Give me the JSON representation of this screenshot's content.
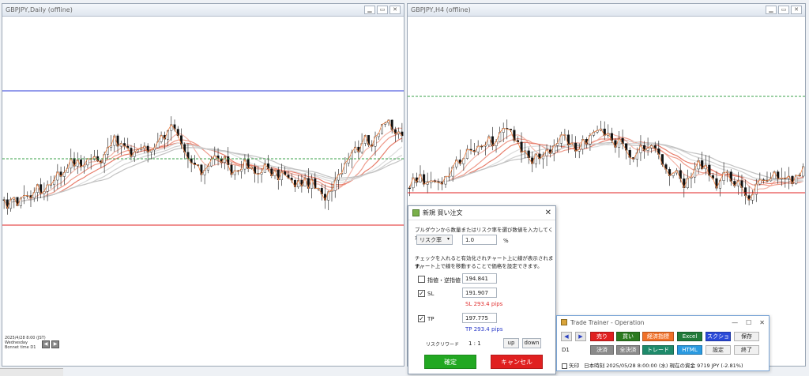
{
  "left_chart": {
    "title": "GBPJPY,Daily (offline)",
    "info_lines": [
      "2025/4/28 8:00 (JST)",
      "Wednesday",
      "Bonnet time    D1"
    ]
  },
  "right_chart": {
    "title": "GBPJPY,H4 (offline)"
  },
  "order_dialog": {
    "title": "新規 買い注文",
    "close_glyph": "✕",
    "instruction_1": "プルダウンから数量またはリスク率を選び数値を入力してください。",
    "mode_select": "リスク率",
    "risk_value": "1.0",
    "percent": "%",
    "instruction_2": "チェックを入れると有効化されチャート上に線が表示されます。",
    "instruction_3": "チャート上で線を移動することで価格を設定できます。",
    "limit_label": "指値・逆指値",
    "limit_value": "194.841",
    "limit_checked": "",
    "sl_label": "SL",
    "sl_value": "191.907",
    "sl_checked": "✓",
    "sl_pips": "SL 293.4 pips",
    "tp_label": "TP",
    "tp_value": "197.775",
    "tp_checked": "✓",
    "tp_pips": "TP 293.4 pips",
    "rr_label": "リスクリワード",
    "rr_value": "1 : 1",
    "up_label": "up",
    "down_label": "down",
    "confirm_label": "確定",
    "cancel_label": "キャンセル",
    "confirm_color": "#22a822",
    "cancel_color": "#e02020"
  },
  "trade_trainer": {
    "title": "Trade Trainer - Operation",
    "ctl_min": "—",
    "ctl_max": "☐",
    "ctl_close": "✕",
    "prev": "◀",
    "next": "▶",
    "sell": "売り",
    "buy": "買い",
    "indicator": "経済指標",
    "excel": "Excel",
    "screenshot": "スクショ",
    "save": "保存",
    "timeframe": "D1",
    "settle": "決済",
    "settle_all": "全決済",
    "trade": "トレード",
    "html": "HTML",
    "settings": "設定",
    "exit": "終了",
    "arrow_label": "矢印",
    "status": "日本時刻 2025/05/28 8:00:00 (水)    現在の資金 9719 JPY (-2.81%)"
  }
}
